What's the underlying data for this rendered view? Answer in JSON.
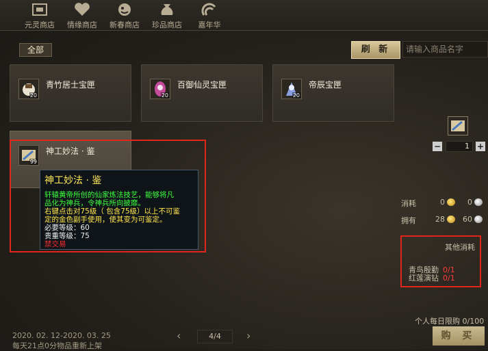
{
  "shop_tabs": [
    {
      "label": "元灵商店",
      "icon": "yuanling-shop-icon"
    },
    {
      "label": "情缘商店",
      "icon": "heart-icon"
    },
    {
      "label": "新春商店",
      "icon": "spring-festival-icon"
    },
    {
      "label": "珍品商店",
      "icon": "treasure-bag-icon"
    },
    {
      "label": "嘉年华",
      "icon": "carnival-icon"
    }
  ],
  "filter": {
    "label": "全部"
  },
  "toolbar": {
    "refresh_label": "刷 新",
    "search_placeholder": "请输入商品名字"
  },
  "items": [
    {
      "name": "青竹居士宝匣",
      "qty": "20"
    },
    {
      "name": "百御仙灵宝匣",
      "qty": "20"
    },
    {
      "name": "帝辰宝匣",
      "qty": "20"
    },
    {
      "name": "神工妙法 · 鉴",
      "qty": "99"
    }
  ],
  "tooltip": {
    "title": "神工妙法 · 鉴",
    "desc_lines": [
      "轩辕黄帝所创的仙家炼法技艺，能够将凡",
      "品化为神兵，令神兵所向披靡。"
    ],
    "usage_lines": [
      "右键点击对75级（ 包含75级）以上不可鉴",
      "定的金色副手使用，使其变为可鉴定。"
    ],
    "level_req": "必要等级：60",
    "rarity_level": "贵重等级：75",
    "trade_status": "禁交易"
  },
  "purchase": {
    "quantity": "1",
    "minus_label": "−",
    "plus_label": "+",
    "cost_label": "消耗",
    "cost_gold": "0",
    "cost_silver": "0",
    "own_label": "拥有",
    "own_gold": "28",
    "own_silver": "60"
  },
  "other_costs": {
    "title": "其他消耗",
    "items": [
      {
        "name": "青鸟殷勤",
        "count": "0/1"
      },
      {
        "name": "红莲演钻",
        "count": "0/1"
      }
    ]
  },
  "daily_limit": "个人每日限购 0/100",
  "buy_label": "购 买",
  "footer": {
    "date_range": "2020. 02. 12-2020. 03. 25",
    "restock": "每天21点0分物品重新上架",
    "page": "4/4",
    "prev_icon": "chevron-left-icon",
    "next_icon": "chevron-right-icon"
  },
  "colors": {
    "highlight": "#e0261b",
    "tooltip_title": "#ffe85a",
    "tooltip_green": "#3cff3c",
    "tooltip_red": "#ff3030"
  }
}
